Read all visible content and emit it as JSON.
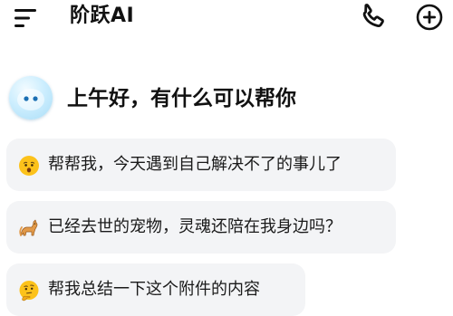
{
  "header": {
    "title": "阶跃AI",
    "menu_icon": "menu-icon",
    "phone_icon": "phone-icon",
    "new_chat_icon": "new-chat-plus-icon"
  },
  "greeting": {
    "text": "上午好，有什么可以帮你",
    "avatar_icon": "assistant-avatar"
  },
  "suggestions": [
    {
      "emoji": "worried-face-icon",
      "text": "帮帮我，今天遇到自己解决不了的事儿了"
    },
    {
      "emoji": "cat-icon",
      "text": "已经去世的宠物，灵魂还陪在我身边吗？"
    },
    {
      "emoji": "thinking-face-icon",
      "text": "帮我总结一下这个附件的内容"
    }
  ],
  "colors": {
    "background": "#ffffff",
    "chip_background": "#f3f4f6",
    "avatar": "#bfe8fb",
    "text": "#111111"
  }
}
